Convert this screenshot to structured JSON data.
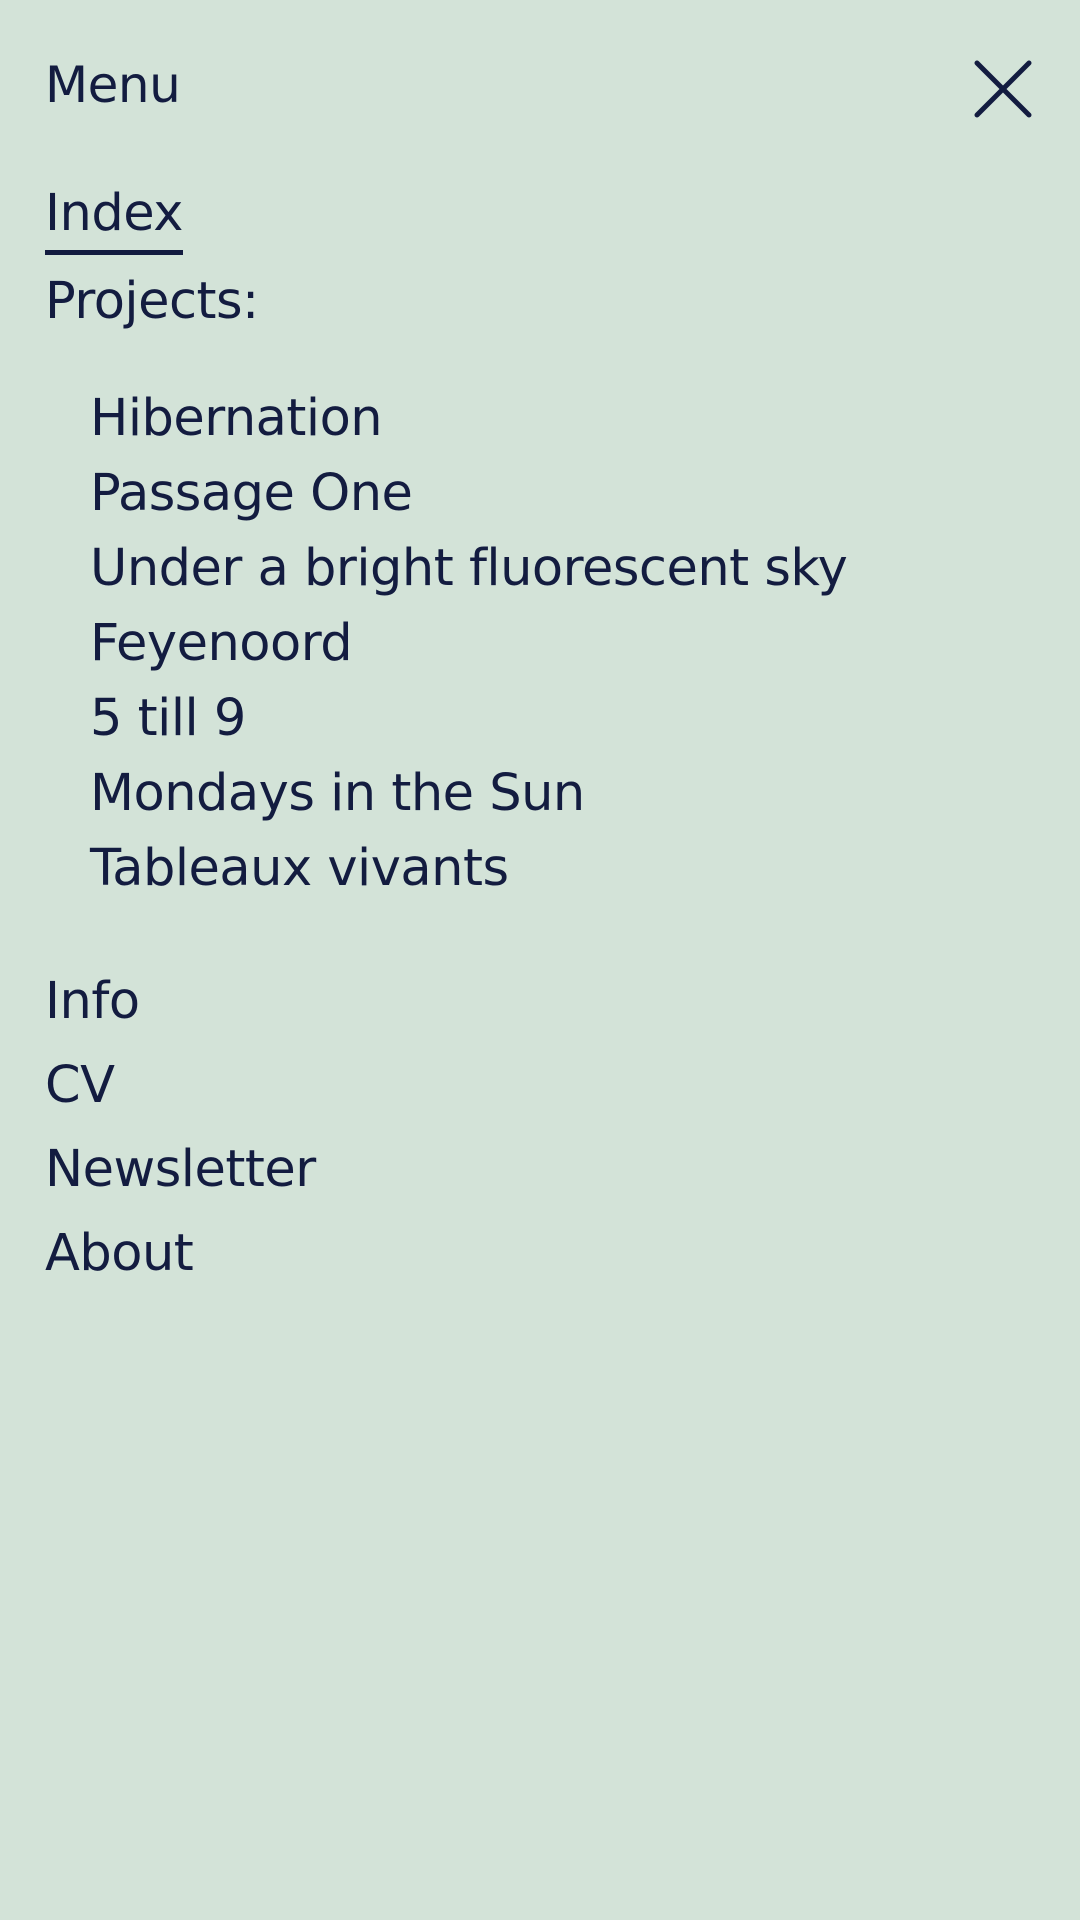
{
  "header": {
    "title": "Menu",
    "close_icon": "close-icon"
  },
  "nav": {
    "index_label": "Index",
    "projects_label": "Projects:",
    "projects": [
      {
        "label": "Hibernation"
      },
      {
        "label": "Passage One"
      },
      {
        "label": "Under a bright fluorescent sky"
      },
      {
        "label": "Feyenoord"
      },
      {
        "label": "5 till 9"
      },
      {
        "label": "Mondays in the Sun"
      },
      {
        "label": "Tableaux vivants"
      }
    ],
    "secondary": [
      {
        "label": "Info"
      },
      {
        "label": "CV"
      },
      {
        "label": "Newsletter"
      },
      {
        "label": "About"
      }
    ]
  },
  "colors": {
    "background": "#d3e3d8",
    "text": "#131c40"
  }
}
